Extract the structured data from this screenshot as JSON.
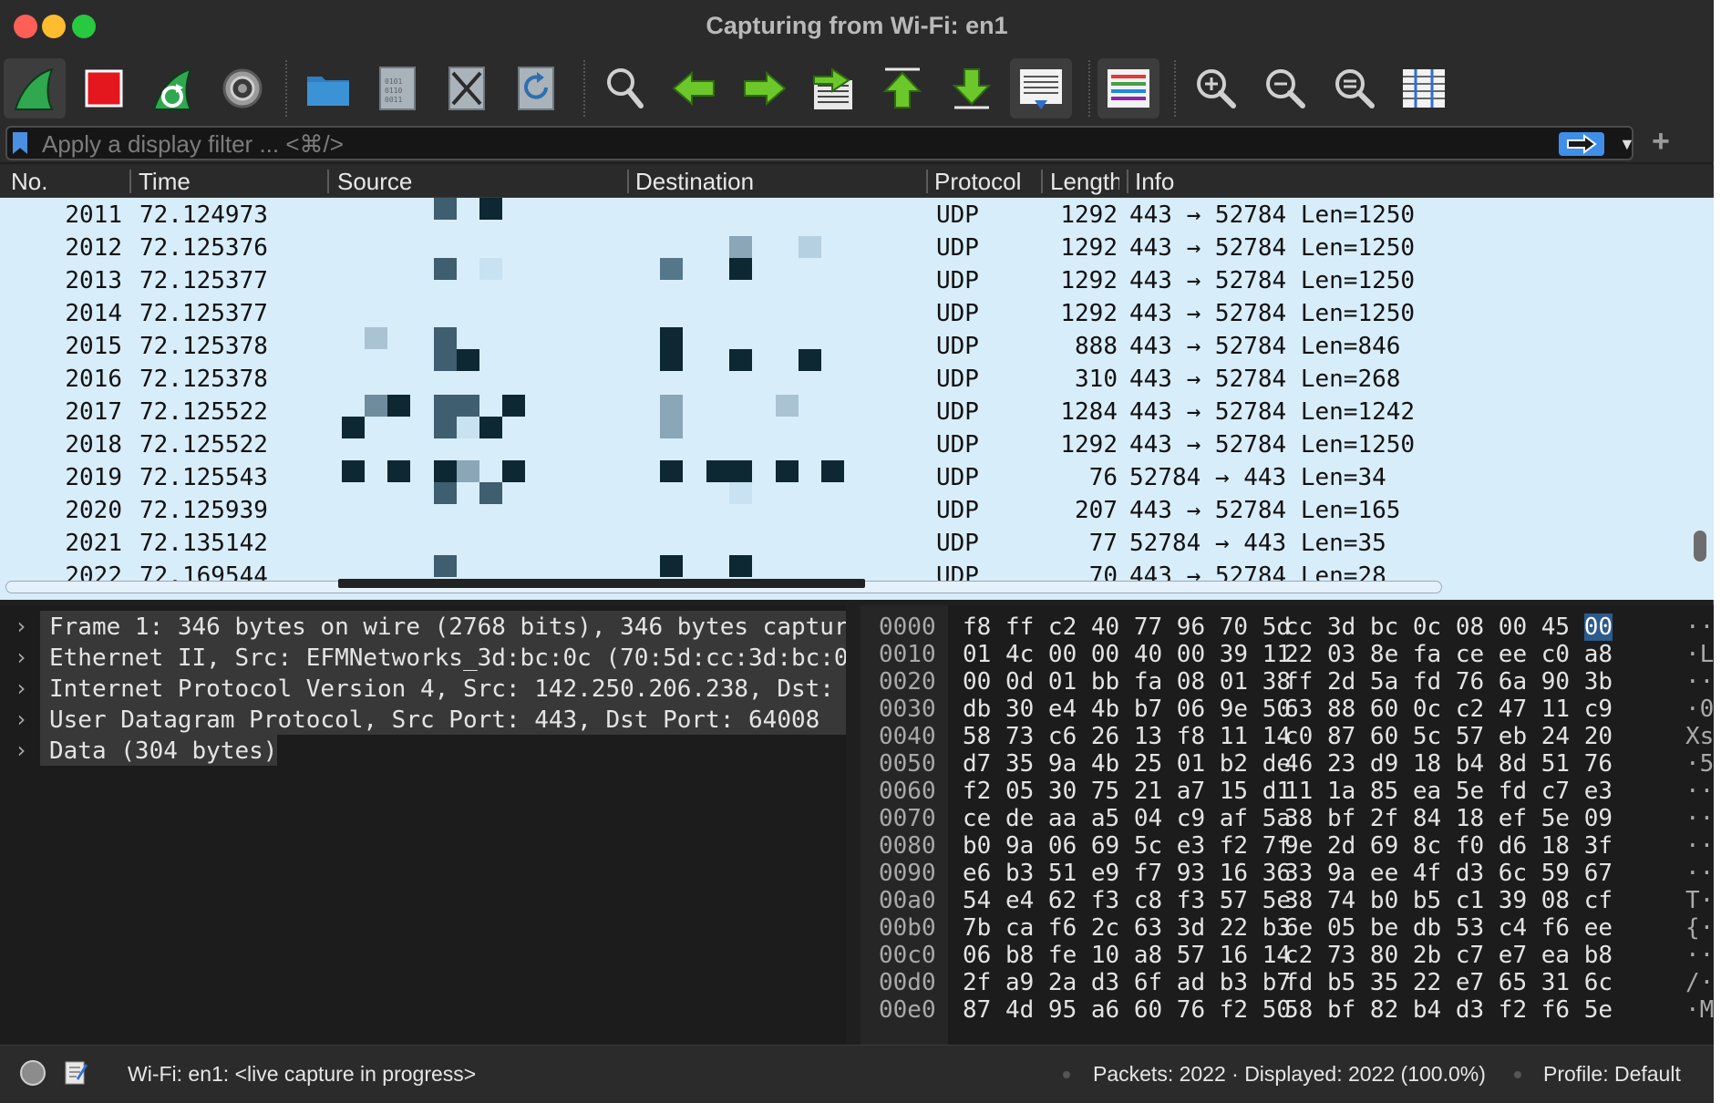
{
  "window": {
    "title": "Capturing from Wi-Fi: en1"
  },
  "colors": {
    "close": "#ff5f57",
    "minimize": "#febc2e",
    "zoom": "#28c840",
    "accent": "#3f8fe8",
    "packet_row_bg": "#d8edfa"
  },
  "toolbar": {
    "buttons": [
      {
        "icon": "shark-fin-start-capture-icon"
      },
      {
        "icon": "stop-capture-icon"
      },
      {
        "icon": "restart-capture-icon"
      },
      {
        "icon": "capture-options-gear-icon"
      },
      {
        "icon": "open-file-folder-icon"
      },
      {
        "icon": "save-file-icon"
      },
      {
        "icon": "close-file-icon"
      },
      {
        "icon": "reload-file-icon"
      },
      {
        "icon": "find-packet-magnifier-icon"
      },
      {
        "icon": "go-back-arrow-icon"
      },
      {
        "icon": "go-forward-arrow-icon"
      },
      {
        "icon": "go-to-packet-icon"
      },
      {
        "icon": "go-to-first-packet-icon"
      },
      {
        "icon": "go-to-last-packet-icon"
      },
      {
        "icon": "auto-scroll-icon"
      },
      {
        "icon": "colorize-icon"
      },
      {
        "icon": "zoom-in-icon"
      },
      {
        "icon": "zoom-out-icon"
      },
      {
        "icon": "normal-size-icon"
      },
      {
        "icon": "resize-columns-icon"
      }
    ]
  },
  "filter": {
    "placeholder": "Apply a display filter ... <⌘/>"
  },
  "packet_list": {
    "columns": [
      "No.",
      "Time",
      "Source",
      "Destination",
      "Protocol",
      "Length",
      "Info"
    ],
    "rows": [
      {
        "no": "2011",
        "time": "72.124973",
        "protocol": "UDP",
        "length": "1292",
        "info": "443 → 52784 Len=1250"
      },
      {
        "no": "2012",
        "time": "72.125376",
        "protocol": "UDP",
        "length": "1292",
        "info": "443 → 52784 Len=1250"
      },
      {
        "no": "2013",
        "time": "72.125377",
        "protocol": "UDP",
        "length": "1292",
        "info": "443 → 52784 Len=1250"
      },
      {
        "no": "2014",
        "time": "72.125377",
        "protocol": "UDP",
        "length": "1292",
        "info": "443 → 52784 Len=1250"
      },
      {
        "no": "2015",
        "time": "72.125378",
        "protocol": "UDP",
        "length": "888",
        "info": "443 → 52784 Len=846"
      },
      {
        "no": "2016",
        "time": "72.125378",
        "protocol": "UDP",
        "length": "310",
        "info": "443 → 52784 Len=268"
      },
      {
        "no": "2017",
        "time": "72.125522",
        "protocol": "UDP",
        "length": "1284",
        "info": "443 → 52784 Len=1242"
      },
      {
        "no": "2018",
        "time": "72.125522",
        "protocol": "UDP",
        "length": "1292",
        "info": "443 → 52784 Len=1250"
      },
      {
        "no": "2019",
        "time": "72.125543",
        "protocol": "UDP",
        "length": "76",
        "info": "52784 → 443 Len=34"
      },
      {
        "no": "2020",
        "time": "72.125939",
        "protocol": "UDP",
        "length": "207",
        "info": "443 → 52784 Len=165"
      },
      {
        "no": "2021",
        "time": "72.135142",
        "protocol": "UDP",
        "length": "77",
        "info": "52784 → 443 Len=35"
      },
      {
        "no": "2022",
        "time": "72.169544",
        "protocol": "UDP",
        "length": "70",
        "info": "443 → 52784 Len=28"
      }
    ]
  },
  "details": {
    "rows": [
      "Frame 1: 346 bytes on wire (2768 bits), 346 bytes captur",
      "Ethernet II, Src: EFMNetworks_3d:bc:0c (70:5d:cc:3d:bc:0",
      "Internet Protocol Version 4, Src: 142.250.206.238, Dst:",
      "User Datagram Protocol, Src Port: 443, Dst Port: 64008",
      "Data (304 bytes)"
    ]
  },
  "bytes": {
    "rows": [
      {
        "off": "0000",
        "b1": "f8 ff c2 40 77 96 70 5d",
        "b2a": "cc 3d bc 0c 08 00 45 ",
        "b2sel": "00",
        "asc": "··"
      },
      {
        "off": "0010",
        "b1": "01 4c 00 00 40 00 39 11",
        "b2a": "22 03 8e fa ce ee c0 a8",
        "b2sel": "",
        "asc": "·L"
      },
      {
        "off": "0020",
        "b1": "00 0d 01 bb fa 08 01 38",
        "b2a": "ff 2d 5a fd 76 6a 90 3b",
        "b2sel": "",
        "asc": "··"
      },
      {
        "off": "0030",
        "b1": "db 30 e4 4b b7 06 9e 50",
        "b2a": "63 88 60 0c c2 47 11 c9",
        "b2sel": "",
        "asc": "·0"
      },
      {
        "off": "0040",
        "b1": "58 73 c6 26 13 f8 11 14",
        "b2a": "c0 87 60 5c 57 eb 24 20",
        "b2sel": "",
        "asc": "Xs"
      },
      {
        "off": "0050",
        "b1": "d7 35 9a 4b 25 01 b2 de",
        "b2a": "46 23 d9 18 b4 8d 51 76",
        "b2sel": "",
        "asc": "·5"
      },
      {
        "off": "0060",
        "b1": "f2 05 30 75 21 a7 15 d1",
        "b2a": "11 1a 85 ea 5e fd c7 e3",
        "b2sel": "",
        "asc": "··"
      },
      {
        "off": "0070",
        "b1": "ce de aa a5 04 c9 af 5a",
        "b2a": "38 bf 2f 84 18 ef 5e 09",
        "b2sel": "",
        "asc": "··"
      },
      {
        "off": "0080",
        "b1": "b0 9a 06 69 5c e3 f2 7f",
        "b2a": "9e 2d 69 8c f0 d6 18 3f",
        "b2sel": "",
        "asc": "··"
      },
      {
        "off": "0090",
        "b1": "e6 b3 51 e9 f7 93 16 36",
        "b2a": "33 9a ee 4f d3 6c 59 67",
        "b2sel": "",
        "asc": "··"
      },
      {
        "off": "00a0",
        "b1": "54 e4 62 f3 c8 f3 57 5e",
        "b2a": "38 74 b0 b5 c1 39 08 cf",
        "b2sel": "",
        "asc": "T·"
      },
      {
        "off": "00b0",
        "b1": "7b ca f6 2c 63 3d 22 b3",
        "b2a": "6e 05 be db 53 c4 f6 ee",
        "b2sel": "",
        "asc": "{·"
      },
      {
        "off": "00c0",
        "b1": "06 b8 fe 10 a8 57 16 14",
        "b2a": "c2 73 80 2b c7 e7 ea b8",
        "b2sel": "",
        "asc": "··"
      },
      {
        "off": "00d0",
        "b1": "2f a9 2a d3 6f ad b3 b7",
        "b2a": "fd b5 35 22 e7 65 31 6c",
        "b2sel": "",
        "asc": "/·"
      },
      {
        "off": "00e0",
        "b1": "87 4d 95 a6 60 76 f2 50",
        "b2a": "58 bf 82 b4 d3 f2 f6 5e",
        "b2sel": "",
        "asc": "·M"
      }
    ]
  },
  "status": {
    "capture": "Wi-Fi: en1: <live capture in progress>",
    "packets": "Packets: 2022 · Displayed: 2022 (100.0%)",
    "profile": "Profile: Default"
  }
}
